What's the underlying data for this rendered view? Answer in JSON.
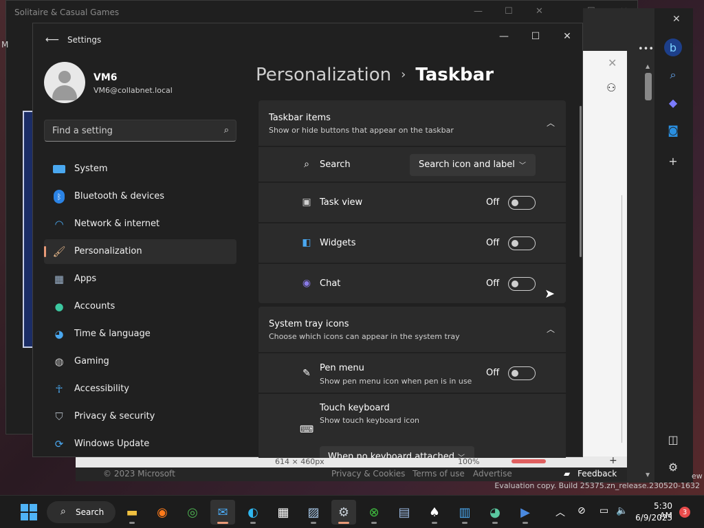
{
  "background": {
    "solitaire_title": "Solitaire & Casual Games",
    "m_letter": "M",
    "footer_copyright": "© 2023 Microsoft",
    "footer_privacy": "Privacy & Cookies",
    "footer_terms": "Terms of use",
    "footer_advertise": "Advertise",
    "footer_feedback": "Feedback",
    "image_size": "614 × 460px",
    "zoom": "100%",
    "evaluation_text": "Evaluation copy. Build 25375.zn_release.230520-1632",
    "edge_cut_text": "ew"
  },
  "settings": {
    "app_title": "Settings",
    "user": {
      "name": "VM6",
      "email": "VM6@collabnet.local"
    },
    "search_placeholder": "Find a setting",
    "nav": [
      {
        "label": "System",
        "icon": "monitor-icon"
      },
      {
        "label": "Bluetooth & devices",
        "icon": "bluetooth-icon"
      },
      {
        "label": "Network & internet",
        "icon": "wifi-icon"
      },
      {
        "label": "Personalization",
        "icon": "brush-icon",
        "active": true
      },
      {
        "label": "Apps",
        "icon": "apps-icon"
      },
      {
        "label": "Accounts",
        "icon": "person-icon"
      },
      {
        "label": "Time & language",
        "icon": "globe-clock-icon"
      },
      {
        "label": "Gaming",
        "icon": "gamepad-icon"
      },
      {
        "label": "Accessibility",
        "icon": "accessibility-icon"
      },
      {
        "label": "Privacy & security",
        "icon": "shield-icon"
      },
      {
        "label": "Windows Update",
        "icon": "update-icon"
      }
    ],
    "breadcrumb": {
      "parent": "Personalization",
      "separator": "›",
      "current": "Taskbar"
    },
    "taskbar_items": {
      "title": "Taskbar items",
      "subtitle": "Show or hide buttons that appear on the taskbar",
      "search": {
        "label": "Search",
        "value": "Search icon and label"
      },
      "task_view": {
        "label": "Task view",
        "state": "Off"
      },
      "widgets": {
        "label": "Widgets",
        "state": "Off"
      },
      "chat": {
        "label": "Chat",
        "state": "Off"
      }
    },
    "system_tray": {
      "title": "System tray icons",
      "subtitle": "Choose which icons can appear in the system tray",
      "pen_menu": {
        "label": "Pen menu",
        "sub": "Show pen menu icon when pen is in use",
        "state": "Off"
      },
      "touch_keyboard": {
        "label": "Touch keyboard",
        "sub": "Show touch keyboard icon",
        "value": "When no keyboard attached"
      }
    }
  },
  "taskbar": {
    "search_label": "Search",
    "time": "5:30 AM",
    "date": "6/9/2023",
    "notification_count": "3"
  },
  "colors": {
    "accent": "#e89a78",
    "start_blue": "#4fb3f6",
    "window_bg": "#202020",
    "card_bg": "#2b2b2b"
  }
}
